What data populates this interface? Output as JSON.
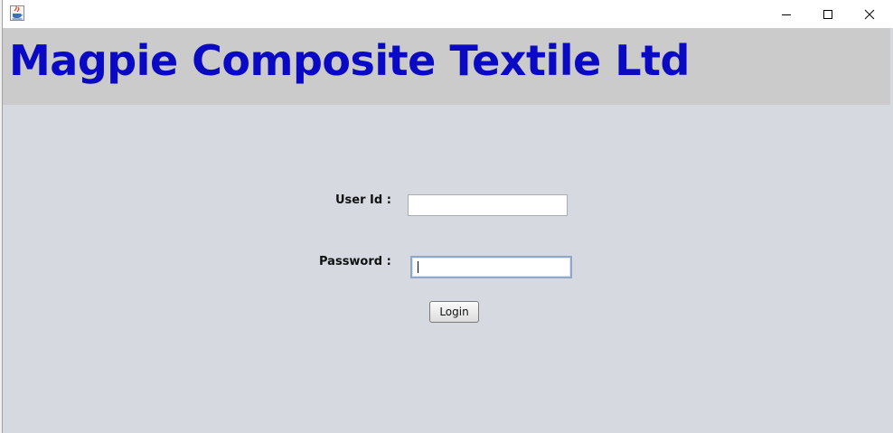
{
  "window": {
    "icon": "java-app-icon",
    "controls": {
      "minimize": "minimize-icon",
      "maximize": "maximize-icon",
      "close": "close-icon"
    }
  },
  "header": {
    "company_name": "Magpie Composite Textile Ltd",
    "text_color": "#0a0ac4",
    "background": "#cbcbcb"
  },
  "login_form": {
    "userid_label": "User Id :",
    "userid_value": "",
    "password_label": "Password :",
    "password_value": "",
    "login_button_label": "Login",
    "background": "#d6d9e0"
  }
}
